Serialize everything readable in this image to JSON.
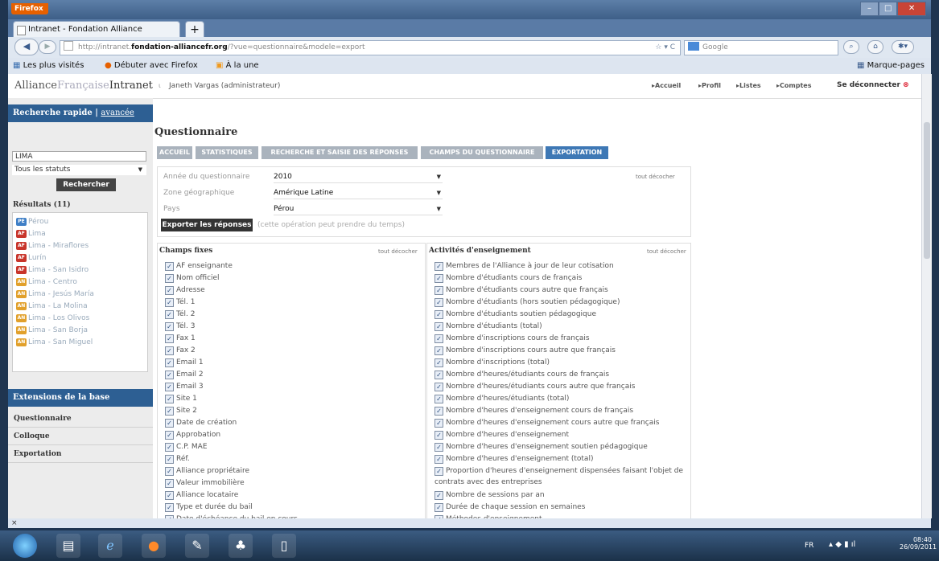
{
  "browser": {
    "app_button": "Firefox",
    "tab_title": "Intranet - Fondation Alliance française",
    "new_tab": "+",
    "url_prefix": "http://intranet.",
    "url_domain": "fondation-alliancefr.org",
    "url_suffix": "/?vue=questionnaire&modele=export",
    "search_placeholder": "Google",
    "bookmarks": [
      "Les plus visités",
      "Débuter avec Firefox",
      "À la une"
    ],
    "bookmarks_menu": "Marque-pages",
    "status_close": "×"
  },
  "header": {
    "brand_1": "Alliance",
    "brand_2": "Française",
    "brand_3": "Intranet",
    "user": "Janeth Vargas (administrateur)",
    "nav": [
      "Accueil",
      "Profil",
      "Listes",
      "Comptes"
    ],
    "logout": "Se déconnecter"
  },
  "sidebar": {
    "search_title": "Recherche rapide",
    "search_sep": "|",
    "search_advanced": "avancée",
    "search_value": "LIMA",
    "status_select": "Tous les statuts",
    "search_button": "Rechercher",
    "results_title": "Résultats (11)",
    "results": [
      {
        "badge": "PE",
        "type": "pe",
        "label": "Pérou"
      },
      {
        "badge": "AF",
        "type": "ag",
        "label": "Lima"
      },
      {
        "badge": "AF",
        "type": "ag",
        "label": "Lima - Miraflores"
      },
      {
        "badge": "AF",
        "type": "ag",
        "label": "Lurín"
      },
      {
        "badge": "AF",
        "type": "ag",
        "label": "Lima - San Isidro"
      },
      {
        "badge": "AN",
        "type": "an",
        "label": "Lima - Centro"
      },
      {
        "badge": "AN",
        "type": "an",
        "label": "Lima - Jesús María"
      },
      {
        "badge": "AN",
        "type": "an",
        "label": "Lima - La Molina"
      },
      {
        "badge": "AN",
        "type": "an",
        "label": "Lima - Los Olivos"
      },
      {
        "badge": "AN",
        "type": "an",
        "label": "Lima - San Borja"
      },
      {
        "badge": "AN",
        "type": "an",
        "label": "Lima - San Miguel"
      }
    ],
    "extensions_title": "Extensions de la base",
    "extensions": [
      "Questionnaire",
      "Colloque",
      "Exportation"
    ]
  },
  "main": {
    "title": "Questionnaire",
    "tabs": [
      "ACCUEIL",
      "STATISTIQUES",
      "RECHERCHE ET SAISIE DES RÉPONSES",
      "CHAMPS DU QUESTIONNAIRE",
      "EXPORTATION"
    ],
    "active_tab": "EXPORTATION",
    "filters": [
      {
        "label": "Année du questionnaire",
        "value": "2010"
      },
      {
        "label": "Zone géographique",
        "value": "Amérique Latine"
      },
      {
        "label": "Pays",
        "value": "Pérou"
      }
    ],
    "uncheck_all": "tout décocher",
    "export_button": "Exporter les réponses",
    "export_note": "(cette opération peut prendre du temps)",
    "fixed_title": "Champs fixes",
    "fixed_fields": [
      "AF enseignante",
      "Nom officiel",
      "Adresse",
      "Tél. 1",
      "Tél. 2",
      "Tél. 3",
      "Fax 1",
      "Fax 2",
      "Email 1",
      "Email 2",
      "Email 3",
      "Site 1",
      "Site 2",
      "Date de création",
      "Approbation",
      "C.P. MAE",
      "Réf.",
      "Alliance propriétaire",
      "Valeur immobilière",
      "Alliance locataire",
      "Type et durée du bail",
      "Date d'échéance du bail en cours"
    ],
    "activities_title": "Activités d'enseignement",
    "activities": [
      "Membres de l'Alliance à jour de leur cotisation",
      "Nombre d'étudiants cours de français",
      "Nombre d'étudiants cours autre que français",
      "Nombre d'étudiants (hors soutien pédagogique)",
      "Nombre d'étudiants soutien pédagogique",
      "Nombre d'étudiants (total)",
      "Nombre d'inscriptions cours de français",
      "Nombre d'inscriptions cours autre que français",
      "Nombre d'inscriptions (total)",
      "Nombre d'heures/étudiants cours de français",
      "Nombre d'heures/étudiants cours autre que français",
      "Nombre d'heures/étudiants (total)",
      "Nombre d'heures d'enseignement cours de français",
      "Nombre d'heures d'enseignement cours autre que français",
      "Nombre d'heures d'enseignement",
      "Nombre d'heures d'enseignement soutien pédagogique",
      "Nombre d'heures d'enseignement (total)",
      "Proportion d'heures d'enseignement dispensées faisant l'objet de contrats avec des entreprises",
      "Nombre de sessions par an",
      "Durée de chaque session en semaines",
      "Méthodes d'enseignement"
    ]
  },
  "taskbar": {
    "lang": "FR",
    "time": "08:40",
    "date": "26/09/2011"
  }
}
